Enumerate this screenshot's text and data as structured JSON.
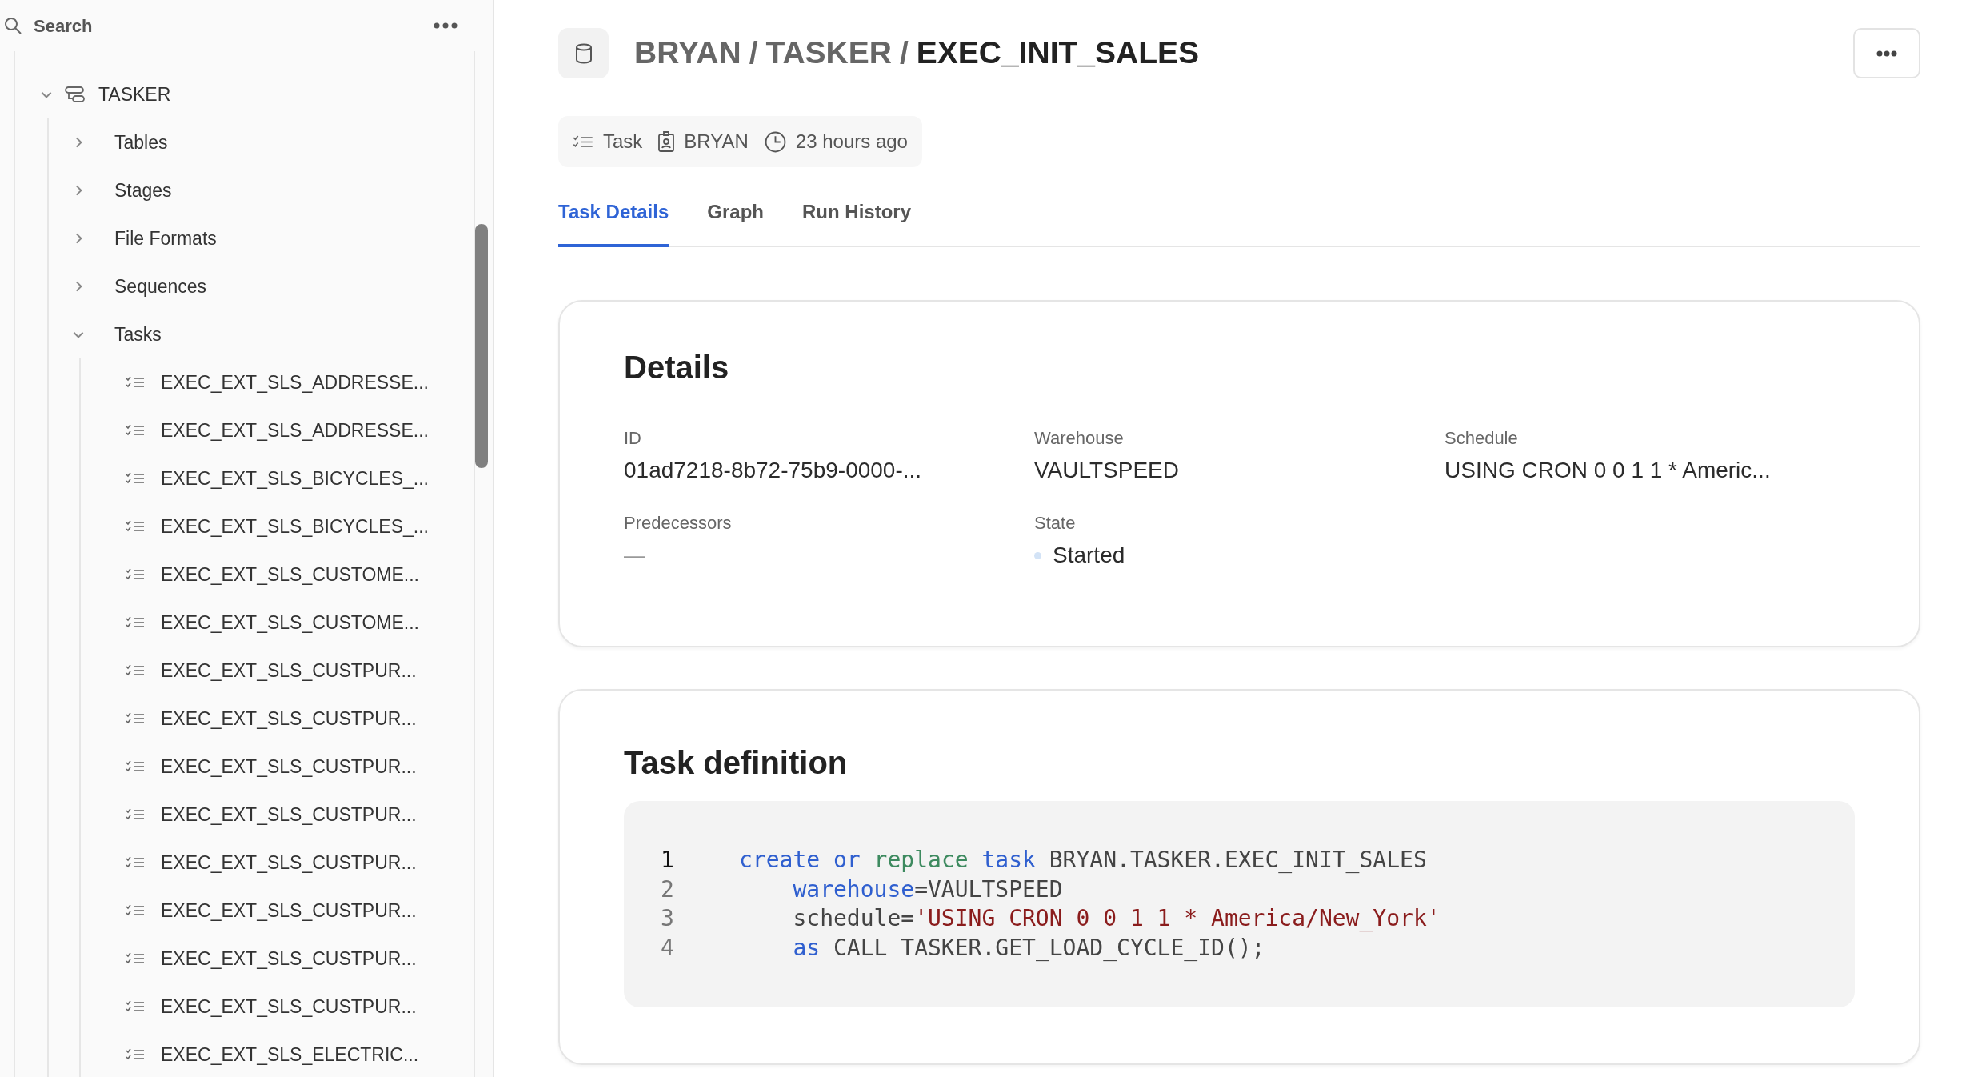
{
  "sidebar": {
    "search": {
      "placeholder": "Search"
    },
    "tree": [
      {
        "label": "TASKER",
        "kind": "schema",
        "expanded": true,
        "children": [
          {
            "label": "Tables",
            "kind": "folder",
            "expanded": false
          },
          {
            "label": "Stages",
            "kind": "folder",
            "expanded": false
          },
          {
            "label": "File Formats",
            "kind": "folder",
            "expanded": false
          },
          {
            "label": "Sequences",
            "kind": "folder",
            "expanded": false
          },
          {
            "label": "Tasks",
            "kind": "folder",
            "expanded": true,
            "children": [
              {
                "label": "EXEC_EXT_SLS_ADDRESSE...",
                "kind": "task"
              },
              {
                "label": "EXEC_EXT_SLS_ADDRESSE...",
                "kind": "task"
              },
              {
                "label": "EXEC_EXT_SLS_BICYCLES_...",
                "kind": "task"
              },
              {
                "label": "EXEC_EXT_SLS_BICYCLES_...",
                "kind": "task"
              },
              {
                "label": "EXEC_EXT_SLS_CUSTOME...",
                "kind": "task"
              },
              {
                "label": "EXEC_EXT_SLS_CUSTOME...",
                "kind": "task"
              },
              {
                "label": "EXEC_EXT_SLS_CUSTPUR...",
                "kind": "task"
              },
              {
                "label": "EXEC_EXT_SLS_CUSTPUR...",
                "kind": "task"
              },
              {
                "label": "EXEC_EXT_SLS_CUSTPUR...",
                "kind": "task"
              },
              {
                "label": "EXEC_EXT_SLS_CUSTPUR...",
                "kind": "task"
              },
              {
                "label": "EXEC_EXT_SLS_CUSTPUR...",
                "kind": "task"
              },
              {
                "label": "EXEC_EXT_SLS_CUSTPUR...",
                "kind": "task"
              },
              {
                "label": "EXEC_EXT_SLS_CUSTPUR...",
                "kind": "task"
              },
              {
                "label": "EXEC_EXT_SLS_CUSTPUR...",
                "kind": "task"
              },
              {
                "label": "EXEC_EXT_SLS_ELECTRIC...",
                "kind": "task"
              }
            ]
          }
        ]
      }
    ]
  },
  "header": {
    "breadcrumb_separator": "/",
    "breadcrumb": [
      {
        "label": "BRYAN",
        "current": false
      },
      {
        "label": "TASKER",
        "current": false
      },
      {
        "label": "EXEC_INIT_SALES",
        "current": true
      }
    ],
    "meta": [
      {
        "kind": "type",
        "text": "Task"
      },
      {
        "kind": "owner",
        "text": "BRYAN"
      },
      {
        "kind": "time",
        "text": "23 hours ago"
      }
    ]
  },
  "tabs": [
    {
      "label": "Task Details",
      "selected": true
    },
    {
      "label": "Graph",
      "selected": false
    },
    {
      "label": "Run History",
      "selected": false
    }
  ],
  "details": {
    "title": "Details",
    "fields": [
      {
        "label": "ID",
        "value": "01ad7218-8b72-75b9-0000-...",
        "kind": "text"
      },
      {
        "label": "Warehouse",
        "value": "VAULTSPEED",
        "kind": "text"
      },
      {
        "label": "Schedule",
        "value": "USING CRON 0 0 1 1 * Americ...",
        "kind": "text"
      },
      {
        "label": "Predecessors",
        "value": "—",
        "kind": "empty"
      },
      {
        "label": "State",
        "value": "Started",
        "kind": "status",
        "color": "#d3e3f6"
      }
    ]
  },
  "definition": {
    "title": "Task definition",
    "lines": [
      {
        "number": "1",
        "active": true,
        "tokens": [
          {
            "kind": "keyword",
            "text": "create"
          },
          {
            "kind": "keyword",
            "text": " or"
          },
          {
            "kind": "builtin",
            "text": " replace"
          },
          {
            "kind": "keyword",
            "text": " task"
          },
          {
            "kind": "plain",
            "text": " BRYAN.TASKER.EXEC_INIT_SALES"
          }
        ]
      },
      {
        "number": "2",
        "active": false,
        "tokens": [
          {
            "kind": "keyword",
            "text": "    warehouse"
          },
          {
            "kind": "plain",
            "text": "=VAULTSPEED"
          }
        ]
      },
      {
        "number": "3",
        "active": false,
        "tokens": [
          {
            "kind": "plain",
            "text": "    schedule="
          },
          {
            "kind": "string",
            "text": "'USING CRON 0 0 1 1 * America/New_York'"
          }
        ]
      },
      {
        "number": "4",
        "active": false,
        "tokens": [
          {
            "kind": "keyword",
            "text": "    as"
          },
          {
            "kind": "plain",
            "text": " CALL TASKER.GET_LOAD_CYCLE_ID();"
          }
        ]
      }
    ]
  }
}
